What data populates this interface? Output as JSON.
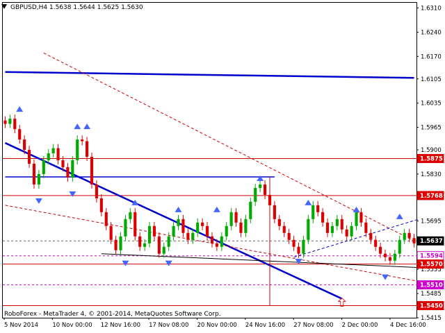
{
  "header": {
    "symbol_line": "GBPUSD,H4  1.5638  1.5644  1.5625  1.5630",
    "copyright": "RoboForex - MetaTrader 4, © 2001-2014, MetaQuotes Software Corp."
  },
  "colors": {
    "background": "#ffffff",
    "frame": "#000000",
    "candle_up": "#00aa00",
    "candle_down": "#dd0000",
    "trend_blue": "#0000cc",
    "level_red": "#cc0000",
    "level_magenta": "#cc00cc",
    "fractal_blue": "#4466ff",
    "arrow_red": "#ee2222"
  },
  "icons": {
    "fractal": "triangle-arrow",
    "target": "up-arrow-outline-icon",
    "scroll": "down-triangle-icon"
  },
  "chart_data": {
    "type": "candlestick",
    "title": "GBPUSD,H4  1.5638  1.5644  1.5625  1.5630",
    "xlabel": "",
    "ylabel": "",
    "ylim": [
      1.5415,
      1.6325
    ],
    "grid": false,
    "y_ticks": [
      "1.6310",
      "1.6240",
      "1.6170",
      "1.6105",
      "1.6035",
      "1.5965",
      "1.5900",
      "1.5830",
      "1.5695",
      "1.5555",
      "1.5485",
      "1.5415"
    ],
    "x_ticks": [
      "5 Nov 2014",
      "10 Nov 00:00",
      "12 Nov 16:00",
      "17 Nov 08:00",
      "20 Nov 00:00",
      "24 Nov 16:00",
      "27 Nov 08:00",
      "2 Dec 00:00",
      "4 Dec 16:00"
    ],
    "price_tags": [
      {
        "label": "1.5875",
        "value": 1.5875,
        "color": "#dd0000",
        "text_color": "#ffffff"
      },
      {
        "label": "1.5768",
        "value": 1.5768,
        "color": "#dd0000",
        "text_color": "#ffffff"
      },
      {
        "label": "1.5637",
        "value": 1.5637,
        "color": "#000000",
        "text_color": "#ffffff"
      },
      {
        "label": "1.5594",
        "value": 1.5594,
        "color": "#ffffff",
        "text_color": "#cc00cc",
        "border": "#cc00cc"
      },
      {
        "label": "1.5570",
        "value": 1.557,
        "color": "#dd0000",
        "text_color": "#ffffff"
      },
      {
        "label": "1.5510",
        "value": 1.551,
        "color": "#cc00cc",
        "text_color": "#ffffff"
      },
      {
        "label": "1.5450",
        "value": 1.545,
        "color": "#dd0000",
        "text_color": "#ffffff"
      }
    ],
    "horizontal_levels": [
      {
        "value": 1.5875,
        "color": "#cc0000",
        "style": "solid"
      },
      {
        "value": 1.5768,
        "color": "#cc0000",
        "style": "solid"
      },
      {
        "value": 1.5637,
        "color": "#666666",
        "style": "dashed"
      },
      {
        "value": 1.5594,
        "color": "#cc00cc",
        "style": "dashed"
      },
      {
        "value": 1.557,
        "color": "#cc0000",
        "style": "solid"
      },
      {
        "value": 1.551,
        "color": "#cc00cc",
        "style": "dashed"
      },
      {
        "value": 1.545,
        "color": "#cc0000",
        "style": "solid"
      }
    ],
    "close_series": [
      1.5975,
      1.599,
      1.596,
      1.593,
      1.59,
      1.586,
      1.58,
      1.583,
      1.587,
      1.589,
      1.5905,
      1.587,
      1.585,
      1.582,
      1.587,
      1.593,
      1.5925,
      1.588,
      1.58,
      1.576,
      1.572,
      1.568,
      1.564,
      1.561,
      1.565,
      1.57,
      1.572,
      1.565,
      1.562,
      1.563,
      1.568,
      1.565,
      1.56,
      1.562,
      1.565,
      1.568,
      1.57,
      1.566,
      1.564,
      1.566,
      1.569,
      1.568,
      1.565,
      1.563,
      1.562,
      1.565,
      1.568,
      1.572,
      1.569,
      1.566,
      1.57,
      1.575,
      1.579,
      1.58,
      1.577,
      1.574,
      1.57,
      1.568,
      1.566,
      1.564,
      1.562,
      1.56,
      1.564,
      1.57,
      1.574,
      1.572,
      1.569,
      1.566,
      1.568,
      1.57,
      1.567,
      1.565,
      1.568,
      1.572,
      1.569,
      1.566,
      1.564,
      1.562,
      1.56,
      1.559,
      1.558,
      1.56,
      1.564,
      1.566,
      1.5645,
      1.563
    ],
    "trend_lines": [
      {
        "color": "#0000cc",
        "width": 2.5,
        "style": "solid",
        "points": [
          [
            0,
            1.6125
          ],
          [
            85,
            1.6108
          ]
        ]
      },
      {
        "color": "#0000cc",
        "width": 2.5,
        "style": "solid",
        "points": [
          [
            0,
            1.592
          ],
          [
            70,
            1.547
          ]
        ]
      },
      {
        "color": "#0000cc",
        "width": 1.5,
        "style": "solid",
        "points": [
          [
            0,
            1.5822
          ],
          [
            56,
            1.5822
          ]
        ]
      },
      {
        "color": "#cc0000",
        "width": 1,
        "style": "dashed",
        "points": [
          [
            8,
            1.618
          ],
          [
            86,
            1.563
          ]
        ]
      },
      {
        "color": "#cc0000",
        "width": 1,
        "style": "dashed",
        "points": [
          [
            0,
            1.574
          ],
          [
            86,
            1.552
          ]
        ]
      },
      {
        "color": "#000000",
        "width": 1,
        "style": "solid",
        "points": [
          [
            20,
            1.56
          ],
          [
            86,
            1.556
          ]
        ]
      },
      {
        "color": "#0000cc",
        "width": 1,
        "style": "dashed",
        "points": [
          [
            60,
            1.559
          ],
          [
            86,
            1.57
          ]
        ]
      },
      {
        "color": "#cc0000",
        "width": 1,
        "style": "solid",
        "points": [
          [
            55,
            1.5822
          ],
          [
            55,
            1.545
          ]
        ]
      }
    ],
    "fractals_up": [
      [
        3,
        1.601
      ],
      [
        15,
        1.596
      ],
      [
        17,
        1.596
      ],
      [
        27,
        1.574
      ],
      [
        36,
        1.572
      ],
      [
        44,
        1.572
      ],
      [
        53,
        1.581
      ],
      [
        63,
        1.574
      ],
      [
        73,
        1.572
      ],
      [
        82,
        1.57
      ]
    ],
    "fractals_down": [
      [
        7,
        1.576
      ],
      [
        14,
        1.578
      ],
      [
        25,
        1.558
      ],
      [
        34,
        1.558
      ],
      [
        61,
        1.5585
      ],
      [
        79,
        1.554
      ]
    ],
    "target_arrow": {
      "index": 70,
      "value": 1.546
    }
  }
}
